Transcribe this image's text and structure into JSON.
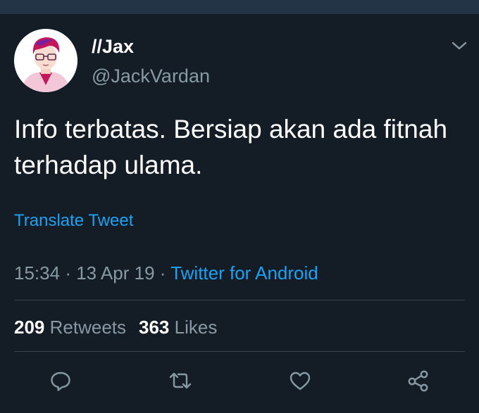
{
  "colors": {
    "background": "#141d26",
    "accent": "#1da1f2",
    "secondary_text": "#8899a6",
    "divider": "#38444d"
  },
  "header": {
    "display_name": "//Jax",
    "handle": "@JackVardan",
    "menu_icon": "chevron-down-icon"
  },
  "tweet": {
    "text": "Info terbatas. Bersiap akan ada fitnah terhadap ulama.",
    "translate_label": "Translate Tweet",
    "time": "15:34",
    "separator": "·",
    "date": "13 Apr 19",
    "source": "Twitter for Android"
  },
  "stats": {
    "retweets_count": "209",
    "retweets_label": "Retweets",
    "likes_count": "363",
    "likes_label": "Likes"
  },
  "actions": [
    {
      "icon": "reply-icon"
    },
    {
      "icon": "retweet-icon"
    },
    {
      "icon": "like-icon"
    },
    {
      "icon": "share-icon"
    }
  ]
}
